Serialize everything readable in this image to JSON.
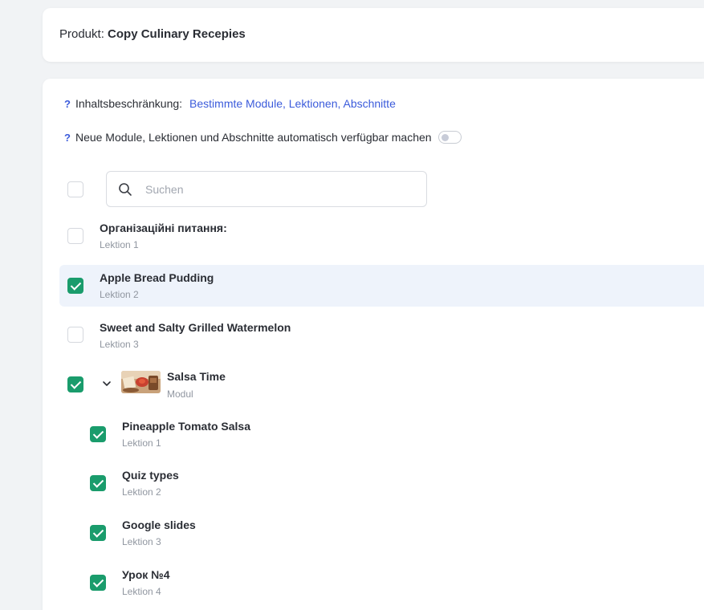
{
  "product": {
    "label": "Produkt:",
    "name": "Copy Culinary Recepies"
  },
  "content_restriction": {
    "help": "?",
    "label": "Inhaltsbeschränkung:",
    "value": "Bestimmte Module, Lektionen, Abschnitte"
  },
  "auto_available": {
    "help": "?",
    "label": "Neue Module, Lektionen und Abschnitte automatisch verfügbar machen",
    "enabled": false
  },
  "search": {
    "placeholder": "Suchen",
    "value": ""
  },
  "items": [
    {
      "title": "Організаційні питання:",
      "subtitle": "Lektion 1",
      "checked": false
    },
    {
      "title": "Apple Bread Pudding",
      "subtitle": "Lektion 2",
      "checked": true
    },
    {
      "title": "Sweet and Salty Grilled Watermelon",
      "subtitle": "Lektion 3",
      "checked": false
    }
  ],
  "module": {
    "title": "Salsa Time",
    "subtitle": "Modul",
    "checked": true,
    "expanded": true,
    "children": [
      {
        "title": "Pineapple Tomato Salsa",
        "subtitle": "Lektion 1",
        "checked": true
      },
      {
        "title": "Quiz types",
        "subtitle": "Lektion 2",
        "checked": true
      },
      {
        "title": "Google slides",
        "subtitle": "Lektion 3",
        "checked": true
      },
      {
        "title": "Урок №4",
        "subtitle": "Lektion 4",
        "checked": true
      }
    ]
  },
  "colors": {
    "accent": "#3b5bdb",
    "check_green": "#1a9c6c",
    "highlight_row": "#eef3fb",
    "page_bg": "#f1f3f5"
  }
}
